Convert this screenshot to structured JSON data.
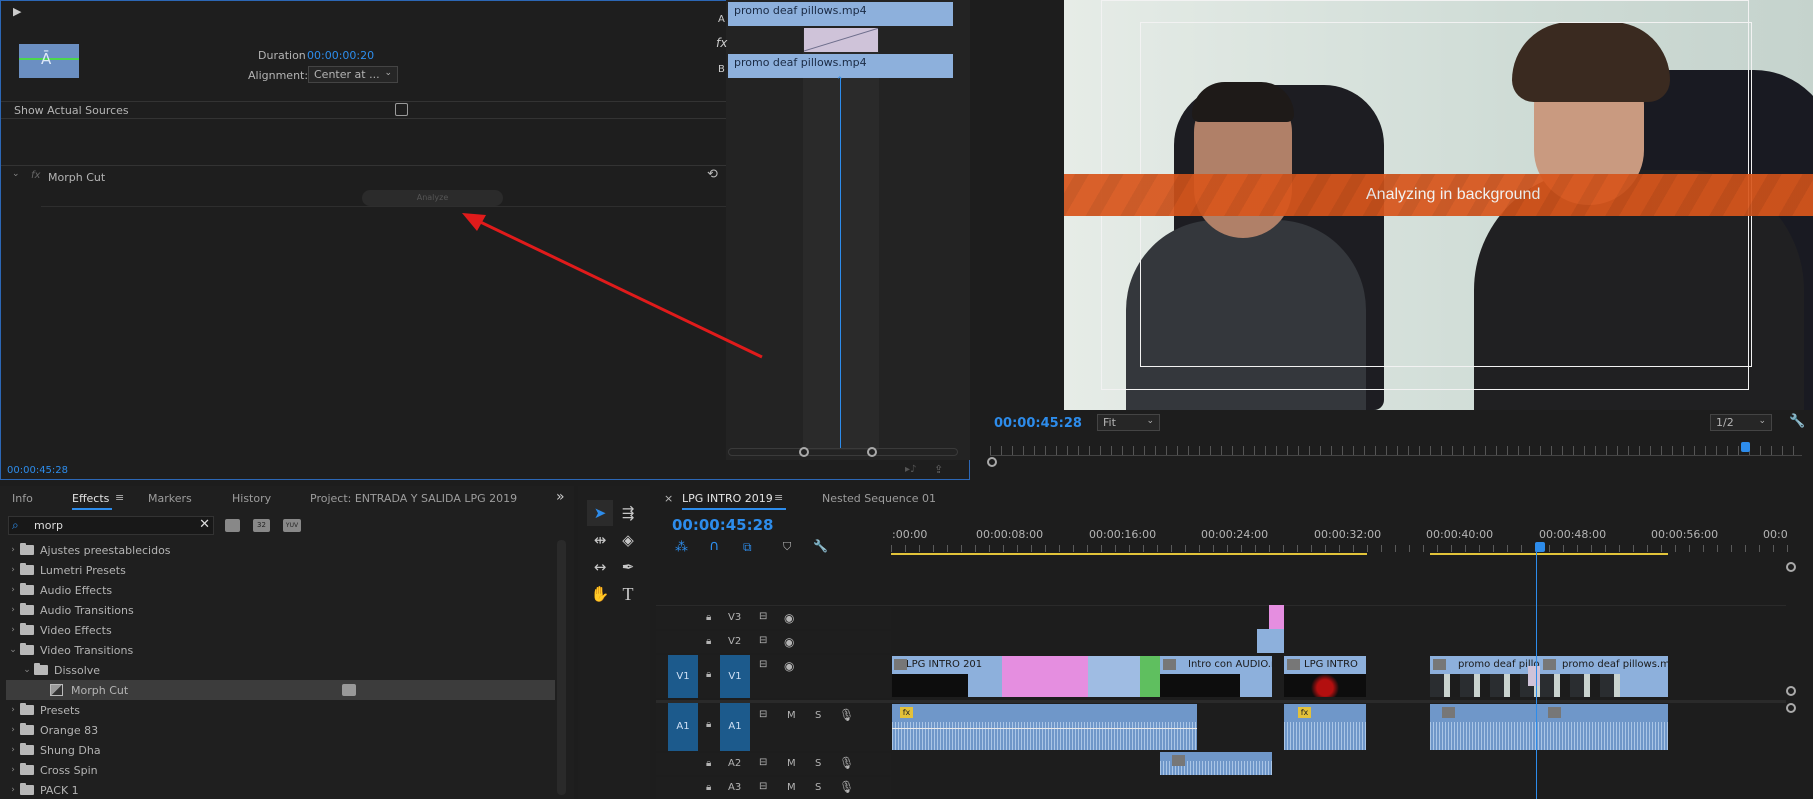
{
  "effect_controls": {
    "play_glyph": "▶",
    "clip_a": "promo deaf pillows.mp4",
    "clip_b": "promo deaf pillows.mp4",
    "track_a": "A",
    "track_b": "B",
    "fx_glyph": "fx",
    "duration_label": "Duration",
    "duration_value": "00:00:00:20",
    "alignment_label": "Alignment:",
    "alignment_value": "Center at ...",
    "show_sources_label": "Show Actual Sources",
    "fx_row_glyph": "fx",
    "effect_name": "Morph Cut",
    "analyze_label": "Analyze",
    "timecode": "00:00:45:28"
  },
  "program_monitor": {
    "overlay_text": "Analyzing in background",
    "timecode": "00:00:45:28",
    "fit_value": "Fit",
    "resolution_value": "1/2"
  },
  "effects_panel": {
    "tabs": [
      "Info",
      "Effects",
      "Markers",
      "History",
      "Project: ENTRADA Y SALIDA LPG 2019"
    ],
    "search_value": "morp",
    "tree": [
      {
        "label": "Ajustes preestablecidos",
        "level": 0,
        "expanded": false,
        "icon": "folder-star-icon"
      },
      {
        "label": "Lumetri Presets",
        "level": 0,
        "expanded": false,
        "icon": "folder-star-icon"
      },
      {
        "label": "Audio Effects",
        "level": 0,
        "expanded": false,
        "icon": "folder-icon"
      },
      {
        "label": "Audio Transitions",
        "level": 0,
        "expanded": false,
        "icon": "folder-icon"
      },
      {
        "label": "Video Effects",
        "level": 0,
        "expanded": false,
        "icon": "folder-icon"
      },
      {
        "label": "Video Transitions",
        "level": 0,
        "expanded": true,
        "icon": "folder-icon"
      },
      {
        "label": "Dissolve",
        "level": 1,
        "expanded": true,
        "icon": "folder-icon"
      },
      {
        "label": "Morph Cut",
        "level": 2,
        "expanded": false,
        "icon": "transition-icon",
        "selected": true
      },
      {
        "label": "Presets",
        "level": 0,
        "expanded": false,
        "icon": "folder-star-icon"
      },
      {
        "label": "Orange 83",
        "level": 0,
        "expanded": false,
        "icon": "folder-star-icon"
      },
      {
        "label": "Shung Dha",
        "level": 0,
        "expanded": false,
        "icon": "folder-star-icon"
      },
      {
        "label": "Cross Spin",
        "level": 0,
        "expanded": false,
        "icon": "folder-star-icon"
      },
      {
        "label": "PACK 1",
        "level": 0,
        "expanded": false,
        "icon": "folder-star-icon"
      }
    ],
    "badge_32": "32",
    "badge_yuv": "YUV"
  },
  "timeline": {
    "tab_active": "LPG INTRO 2019",
    "tab_other": "Nested Sequence 01",
    "timecode": "00:00:45:28",
    "ruler": [
      ":00:00",
      "00:00:08:00",
      "00:00:16:00",
      "00:00:24:00",
      "00:00:32:00",
      "00:00:40:00",
      "00:00:48:00",
      "00:00:56:00",
      "00:0"
    ],
    "tracks": {
      "v3": "V3",
      "v2": "V2",
      "v1": "V1",
      "a1": "A1",
      "a2": "A2",
      "a3": "A3",
      "m": "M",
      "s": "S"
    },
    "clips": {
      "lpg_intro_1": "LPG INTRO 201",
      "intro_audio": "Intro con AUDIO.mp",
      "lpg_intro_2": "LPG INTRO",
      "promo_1": "promo deaf pillo",
      "promo_2": "promo deaf pillows.mp"
    },
    "fx_badge": "fx"
  },
  "colors": {
    "accent_blue": "#2d8ceb",
    "clip_blue": "#8db0dc",
    "clip_pink": "#e58ee0",
    "clip_green": "#5fbf5f",
    "overlay_orange": "#d8561c",
    "arrow_red": "#e01b1b",
    "work_area_yellow": "#e2c43a"
  }
}
